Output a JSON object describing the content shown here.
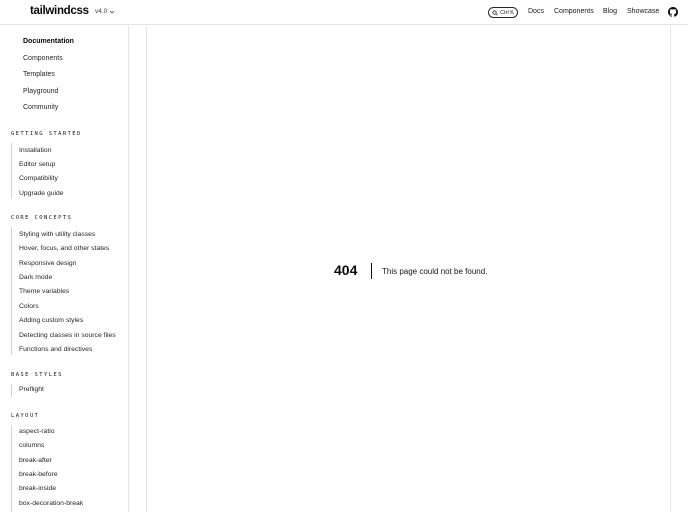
{
  "header": {
    "logo": "tailwindcss",
    "version": "v4.0",
    "search_shortcut": "Ctrl K",
    "nav": [
      "Docs",
      "Components",
      "Blog",
      "Showcase"
    ]
  },
  "sidebar": {
    "top_links": [
      {
        "label": "Documentation",
        "active": true
      },
      {
        "label": "Components",
        "active": false
      },
      {
        "label": "Templates",
        "active": false
      },
      {
        "label": "Playground",
        "active": false
      },
      {
        "label": "Community",
        "active": false
      }
    ],
    "sections": [
      {
        "title": "GETTING STARTED",
        "items": [
          "Installation",
          "Editor setup",
          "Compatibility",
          "Upgrade guide"
        ]
      },
      {
        "title": "CORE CONCEPTS",
        "items": [
          "Styling with utility classes",
          "Hover, focus, and other states",
          "Responsive design",
          "Dark mode",
          "Theme variables",
          "Colors",
          "Adding custom styles",
          "Detecting classes in source files",
          "Functions and directives"
        ]
      },
      {
        "title": "BASE STYLES",
        "items": [
          "Preflight"
        ]
      },
      {
        "title": "LAYOUT",
        "items": [
          "aspect-ratio",
          "columns",
          "break-after",
          "break-before",
          "break-inside",
          "box-decoration-break"
        ]
      }
    ]
  },
  "not_found": {
    "code": "404",
    "message": "This page could not be found."
  }
}
